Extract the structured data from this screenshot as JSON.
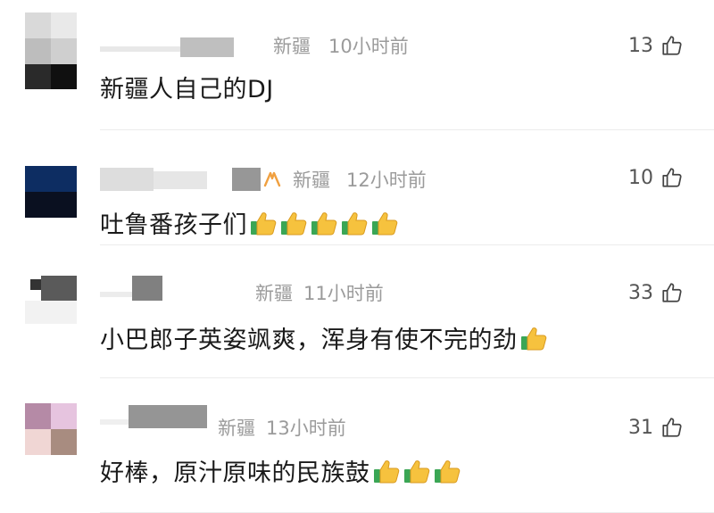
{
  "comments": [
    {
      "location": "新疆",
      "time": "10小时前",
      "text": "新疆人自己的DJ",
      "likes": "13",
      "emoji_count": 0,
      "has_badge": false
    },
    {
      "location": "新疆",
      "time": "12小时前",
      "text": "吐鲁番孩子们",
      "likes": "10",
      "emoji_count": 5,
      "has_badge": true
    },
    {
      "location": "新疆",
      "time": "11小时前",
      "text": "小巴郎子英姿飒爽，浑身有使不完的劲",
      "likes": "33",
      "emoji_count": 1,
      "has_badge": false
    },
    {
      "location": "新疆",
      "time": "13小时前",
      "text": "好棒，原汁原味的民族鼓",
      "likes": "31",
      "emoji_count": 3,
      "has_badge": false
    }
  ],
  "icons": {
    "like": "thumbs-up-outline-icon",
    "emoji": "thumbs-up-emoji-icon",
    "badge": "membership-badge-icon"
  },
  "colors": {
    "text": "#1a1a1a",
    "meta": "#9b9b9b",
    "emoji_yellow": "#f6c23e",
    "emoji_green": "#3aa655",
    "badge_orange": "#f0a040"
  }
}
